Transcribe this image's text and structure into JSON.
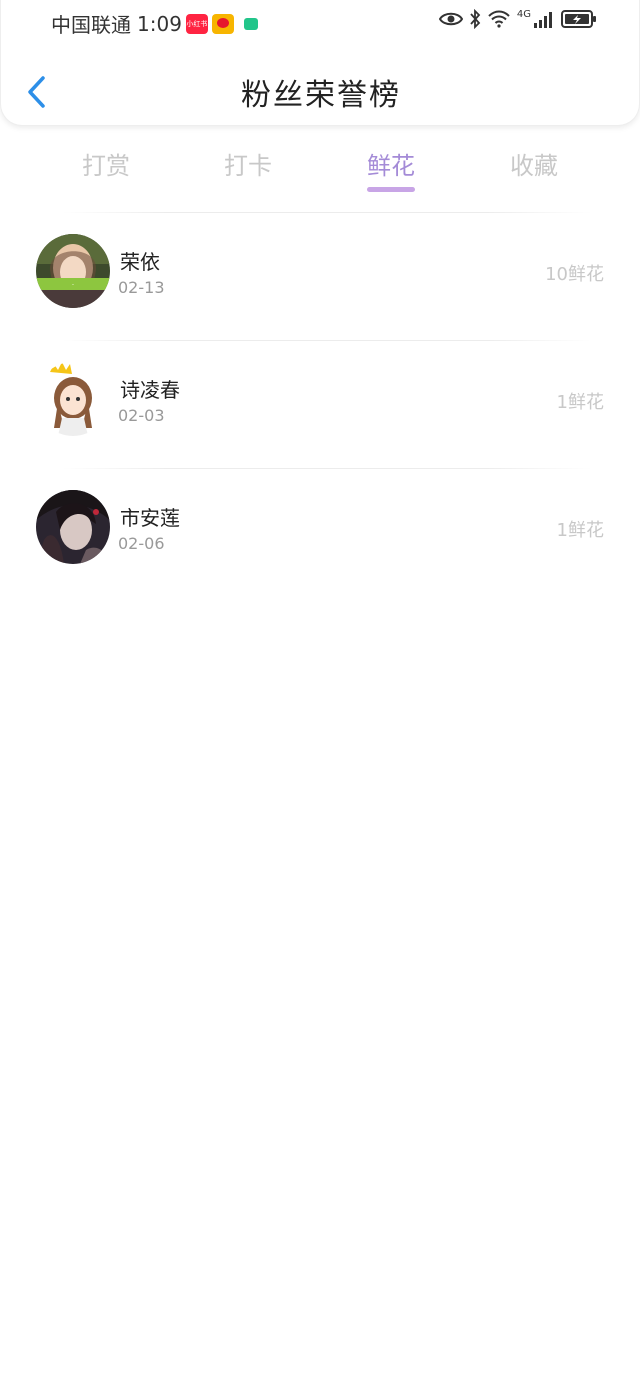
{
  "status_bar": {
    "carrier": "中国联通",
    "time": "1:09",
    "app_badges": [
      "小红书"
    ],
    "network": "4G"
  },
  "header": {
    "title": "粉丝荣誉榜",
    "back_icon": "chevron-left-icon",
    "accent_color": "#2d8fe8"
  },
  "tabs": [
    {
      "label": "打赏",
      "active": false
    },
    {
      "label": "打卡",
      "active": false
    },
    {
      "label": "鲜花",
      "active": true
    },
    {
      "label": "收藏",
      "active": false
    }
  ],
  "active_tab_color": "#a48bd7",
  "fans": [
    {
      "name": "荣依",
      "date": "02-13",
      "count": "10鲜花"
    },
    {
      "name": "诗凌春",
      "date": "02-03",
      "count": "1鲜花"
    },
    {
      "name": "市安莲",
      "date": "02-06",
      "count": "1鲜花"
    }
  ]
}
